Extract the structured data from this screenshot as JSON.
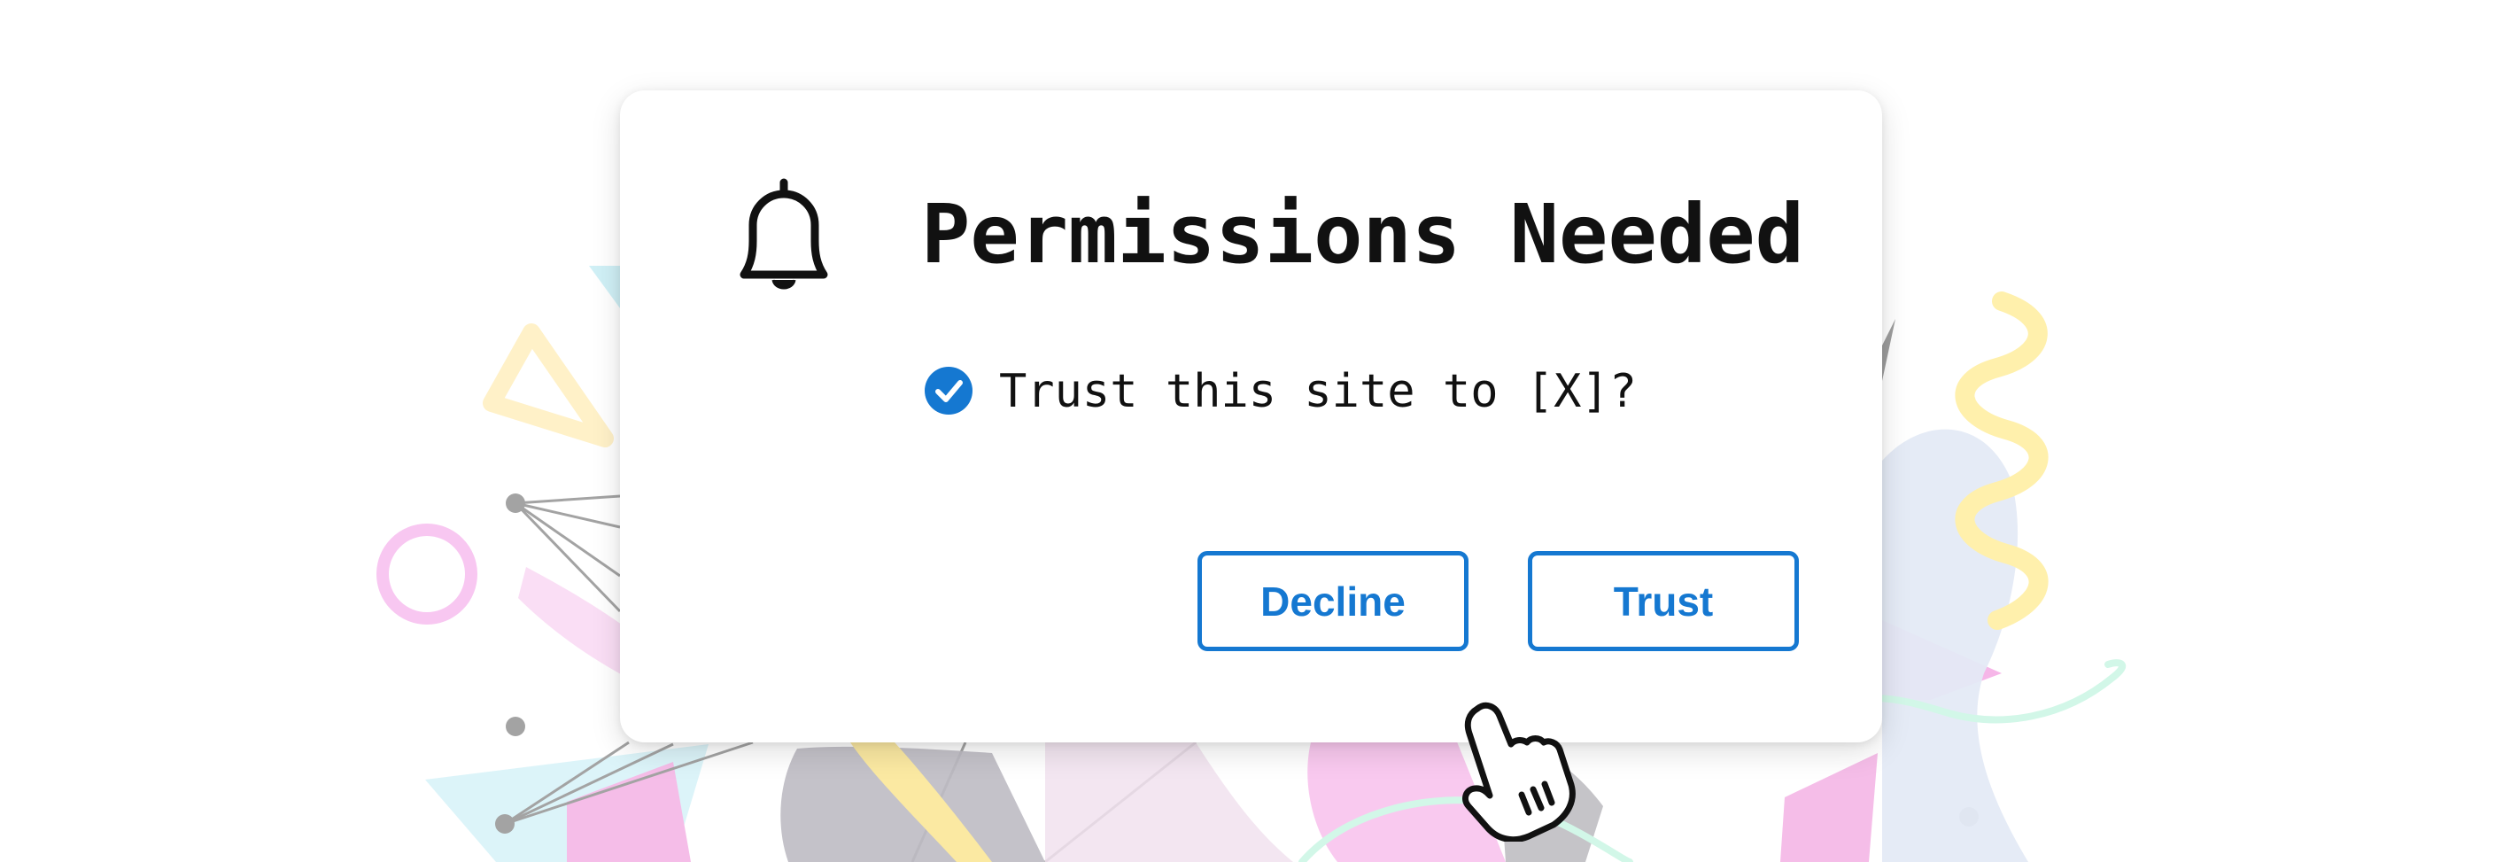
{
  "dialog": {
    "title": "Permissions Needed",
    "message": "Trust this site to [X]?",
    "icon": "bell-icon",
    "check_icon": "check-circle-icon"
  },
  "buttons": {
    "decline_label": "Decline",
    "trust_label": "Trust"
  },
  "cursor": {
    "icon": "hand-pointer-icon"
  },
  "colors": {
    "accent": "#1578d1",
    "text": "#111111",
    "dialog_bg": "#ffffff"
  }
}
